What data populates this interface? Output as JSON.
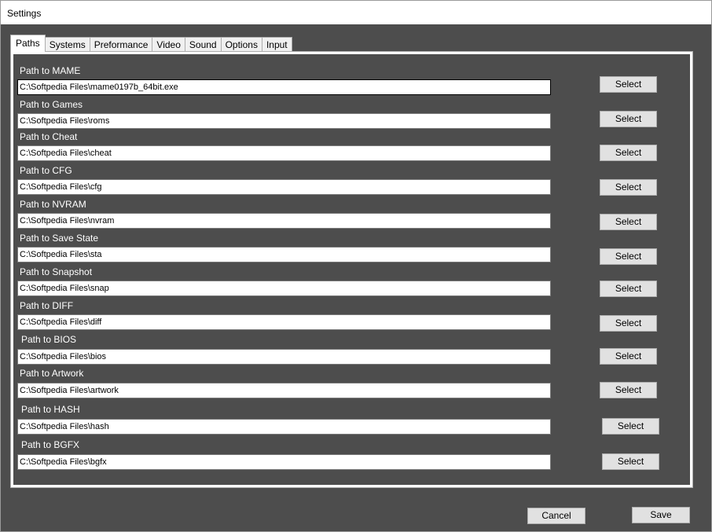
{
  "window": {
    "title": "Settings"
  },
  "tabs": [
    {
      "label": "Paths",
      "active": true
    },
    {
      "label": "Systems",
      "active": false
    },
    {
      "label": "Preformance",
      "active": false
    },
    {
      "label": "Video",
      "active": false
    },
    {
      "label": "Sound",
      "active": false
    },
    {
      "label": "Options",
      "active": false
    },
    {
      "label": "Input",
      "active": false
    }
  ],
  "paths": [
    {
      "label": "Path to MAME",
      "value": "C:\\Softpedia Files\\mame0197b_64bit.exe",
      "button": "Select"
    },
    {
      "label": "Path to Games",
      "value": "C:\\Softpedia Files\\roms",
      "button": "Select"
    },
    {
      "label": "Path to Cheat",
      "value": "C:\\Softpedia Files\\cheat",
      "button": "Select"
    },
    {
      "label": "Path to CFG",
      "value": "C:\\Softpedia Files\\cfg",
      "button": "Select"
    },
    {
      "label": "Path to NVRAM",
      "value": "C:\\Softpedia Files\\nvram",
      "button": "Select"
    },
    {
      "label": "Path to Save State",
      "value": "C:\\Softpedia Files\\sta",
      "button": "Select"
    },
    {
      "label": "Path to Snapshot",
      "value": "C:\\Softpedia Files\\snap",
      "button": "Select"
    },
    {
      "label": "Path to DIFF",
      "value": "C:\\Softpedia Files\\diff",
      "button": "Select"
    },
    {
      "label": "Path to BIOS",
      "value": "C:\\Softpedia Files\\bios",
      "button": "Select"
    },
    {
      "label": "Path to Artwork",
      "value": "C:\\Softpedia Files\\artwork",
      "button": "Select"
    },
    {
      "label": "Path to HASH",
      "value": "C:\\Softpedia Files\\hash",
      "button": "Select"
    },
    {
      "label": "Path to BGFX",
      "value": "C:\\Softpedia Files\\bgfx",
      "button": "Select"
    }
  ],
  "footer": {
    "cancel_label": "Cancel",
    "save_label": "Save"
  },
  "colors": {
    "background": "#4d4d4d",
    "panel": "#ffffff",
    "button": "#e1e1e1",
    "label_text": "#ffffff"
  }
}
